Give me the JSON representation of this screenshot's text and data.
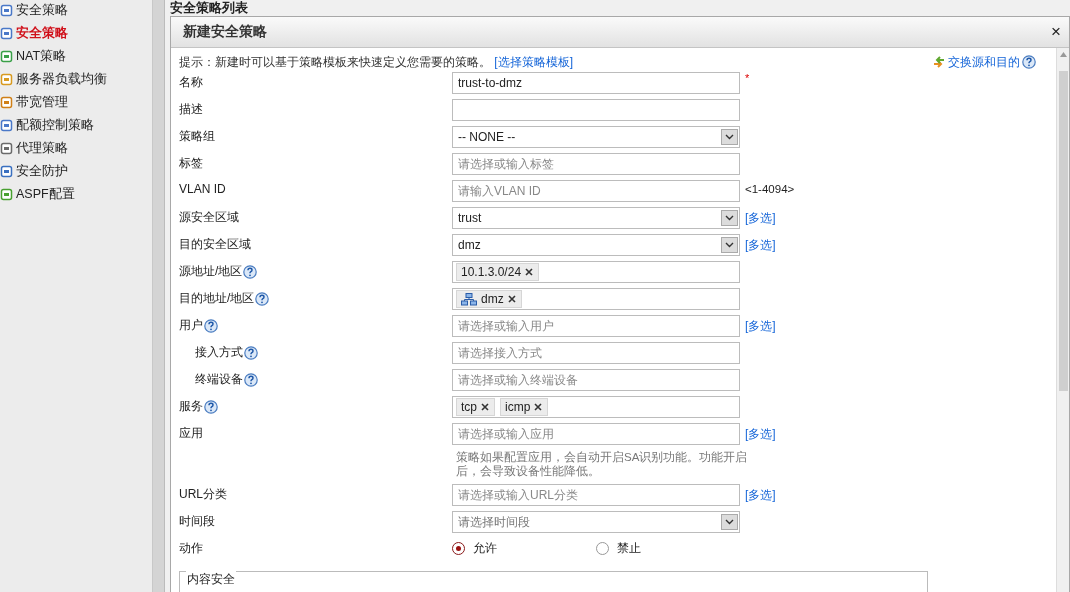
{
  "sidebar": {
    "items": [
      {
        "label": "安全策略",
        "selected": false
      },
      {
        "label": "安全策略",
        "selected": true
      },
      {
        "label": "NAT策略",
        "selected": false
      },
      {
        "label": "服务器负载均衡",
        "selected": false
      },
      {
        "label": "带宽管理",
        "selected": false
      },
      {
        "label": "配额控制策略",
        "selected": false
      },
      {
        "label": "代理策略",
        "selected": false
      },
      {
        "label": "安全防护",
        "selected": false
      },
      {
        "label": "ASPF配置",
        "selected": false
      }
    ]
  },
  "page_title": "安全策略列表",
  "dialog": {
    "title": "新建安全策略",
    "close": "×",
    "hint": "提示：新建时可以基于策略模板来快速定义您需要的策略。",
    "hint_link": "[选择策略模板]",
    "swap_link": "交换源和目的",
    "fields": [
      {
        "kind": "text",
        "label": "名称",
        "value": "trust-to-dmz",
        "required_mark": "*"
      },
      {
        "kind": "text",
        "label": "描述"
      },
      {
        "kind": "select",
        "label": "策略组",
        "value": "-- NONE --"
      },
      {
        "kind": "text",
        "label": "标签",
        "placeholder": "请选择或输入标签"
      },
      {
        "kind": "text",
        "label": "VLAN ID",
        "placeholder": "请输入VLAN ID",
        "suffix": "<1-4094>"
      },
      {
        "kind": "select",
        "label": "源安全区域",
        "value": "trust",
        "link": "[多选]"
      },
      {
        "kind": "select",
        "label": "目的安全区域",
        "value": "dmz",
        "link": "[多选]"
      },
      {
        "kind": "tags",
        "label": "源地址/地区",
        "help": true,
        "tags": [
          {
            "text": "10.1.3.0/24",
            "kind": "plain"
          }
        ]
      },
      {
        "kind": "tags",
        "label": "目的地址/地区",
        "help": true,
        "tags": [
          {
            "text": "dmz",
            "kind": "zone"
          }
        ]
      },
      {
        "kind": "text",
        "label": "用户",
        "help": true,
        "placeholder": "请选择或输入用户",
        "link": "[多选]",
        "children": [
          {
            "kind": "text",
            "label": "接入方式",
            "help": true,
            "placeholder": "请选择接入方式"
          },
          {
            "kind": "text",
            "label": "终端设备",
            "help": true,
            "placeholder": "请选择或输入终端设备"
          }
        ]
      },
      {
        "kind": "tags",
        "label": "服务",
        "help": true,
        "tags": [
          {
            "text": "tcp",
            "kind": "plain"
          },
          {
            "text": "icmp",
            "kind": "plain"
          }
        ]
      },
      {
        "kind": "text",
        "label": "应用",
        "placeholder": "请选择或输入应用",
        "link": "[多选]",
        "note": "策略如果配置应用，会自动开启SA识别功能。功能开启后，会导致设备性能降低。"
      },
      {
        "kind": "text",
        "label": "URL分类",
        "placeholder": "请选择或输入URL分类",
        "link": "[多选]"
      },
      {
        "kind": "select",
        "label": "时间段",
        "placeholder": "请选择时间段"
      },
      {
        "kind": "radio",
        "label": "动作",
        "options": [
          {
            "label": "允许",
            "selected": true
          },
          {
            "label": "禁止",
            "selected": false
          }
        ]
      }
    ],
    "section": "内容安全"
  }
}
